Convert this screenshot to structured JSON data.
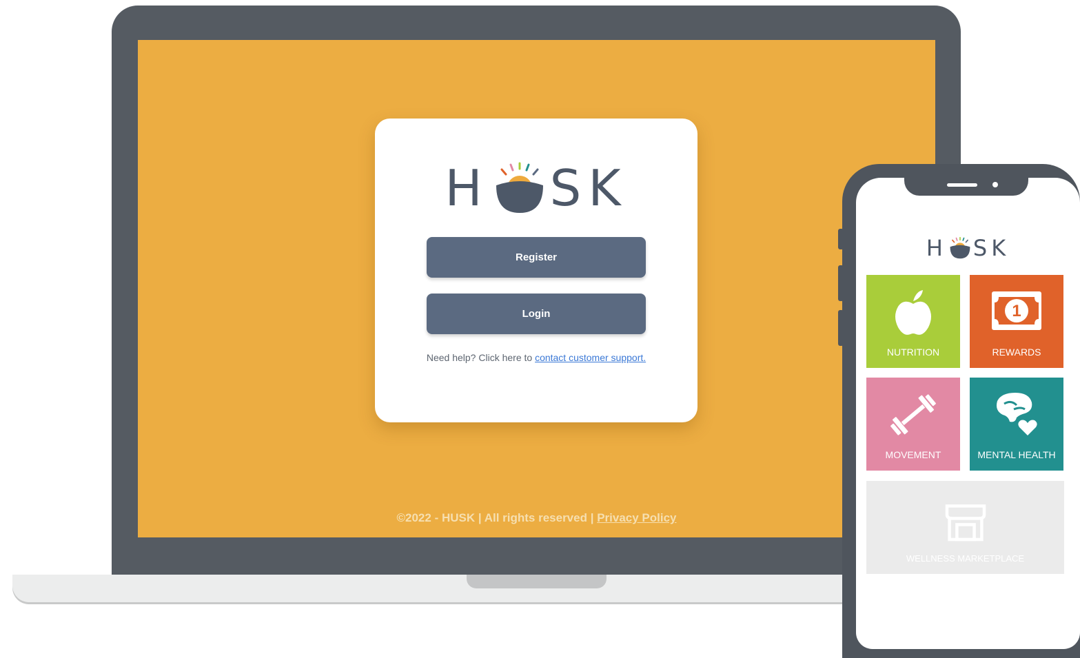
{
  "laptop": {
    "brand": "HUSK",
    "register_label": "Register",
    "login_label": "Login",
    "help_text": "Need help? Click here to ",
    "help_link": "contact customer support.",
    "footer_text": "©2022 - HUSK | All rights reserved | ",
    "footer_link": "Privacy Policy"
  },
  "phone": {
    "brand": "HUSK",
    "tiles": [
      {
        "label": "NUTRITION",
        "icon": "apple-icon",
        "color": "#a9cd3a"
      },
      {
        "label": "REWARDS",
        "icon": "banknote-icon",
        "color": "#e0622a"
      },
      {
        "label": "MOVEMENT",
        "icon": "dumbbell-icon",
        "color": "#e289a4"
      },
      {
        "label": "MENTAL HEALTH",
        "icon": "brain-heart-icon",
        "color": "#22908f"
      },
      {
        "label": "WELLNESS MARKETPLACE",
        "icon": "storefront-icon",
        "color": "#ebebeb"
      }
    ]
  },
  "colors": {
    "screen_bg": "#ecad42",
    "button": "#5b6a81",
    "brand_text": "#4d5868",
    "logo_sun": "#eeaa3e",
    "logo_bowl": "#4d5868"
  }
}
